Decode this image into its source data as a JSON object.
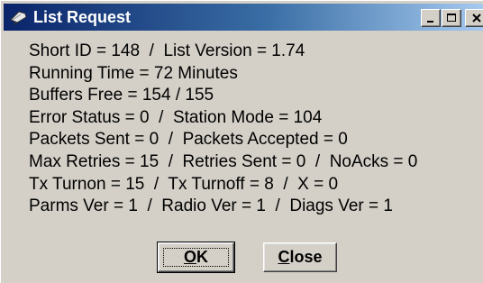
{
  "window": {
    "title": "List Request",
    "icon": "satellite-dish-icon",
    "titlebar_colors": [
      "#0a246a",
      "#a6caf0"
    ]
  },
  "info_lines": [
    "Short ID = 148  /  List Version = 1.74",
    "Running Time = 72 Minutes",
    "Buffers Free = 154 / 155",
    "Error Status = 0  /  Station Mode = 104",
    "Packets Sent = 0  /  Packets Accepted = 0",
    "Max Retries = 15  /  Retries Sent = 0  /  NoAcks = 0",
    "Tx Turnon = 15  /  Tx Turnoff = 8  /  X = 0",
    "Parms Ver = 1  /  Radio Ver = 1  /  Diags Ver = 1"
  ],
  "buttons": {
    "ok_first": "O",
    "ok_rest": "K",
    "close_first": "C",
    "close_rest": "lose"
  }
}
